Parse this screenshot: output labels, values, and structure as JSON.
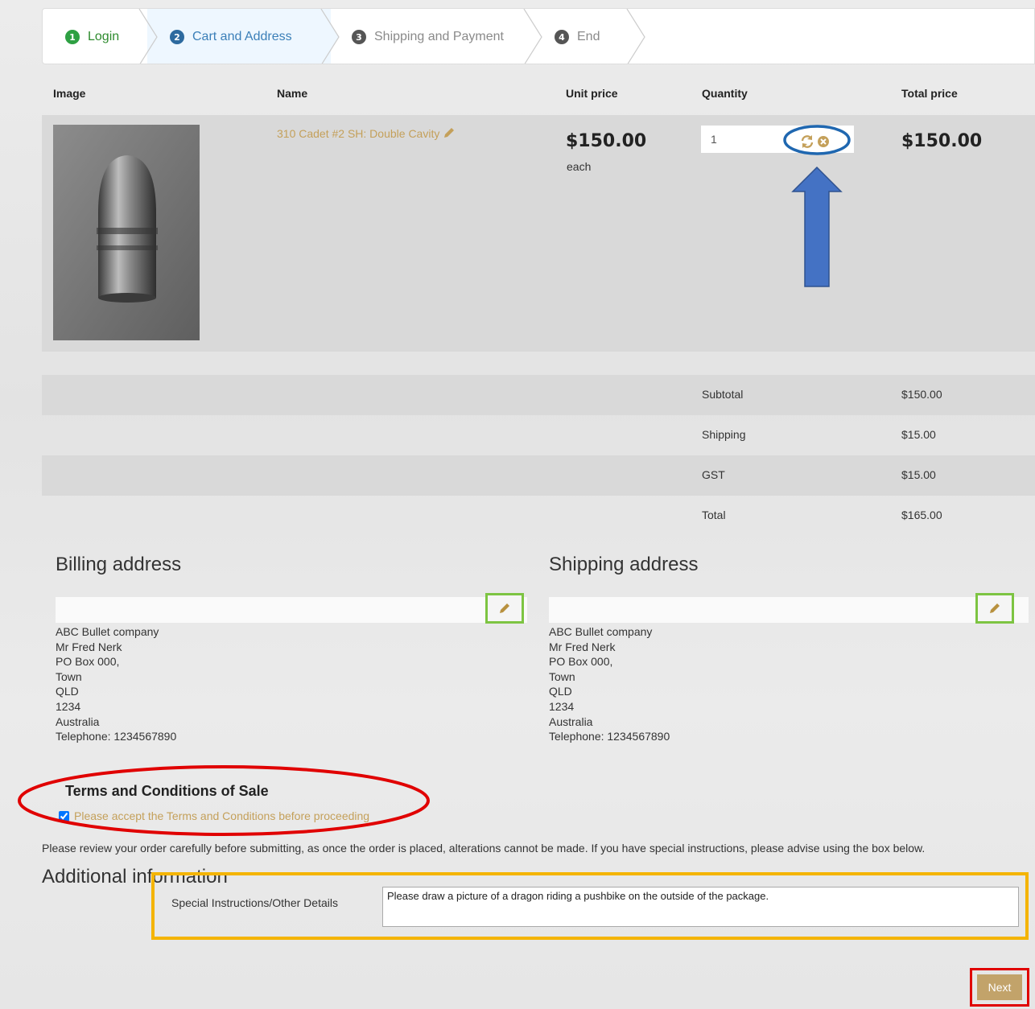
{
  "steps": [
    {
      "num": "1",
      "label": "Login"
    },
    {
      "num": "2",
      "label": "Cart and Address"
    },
    {
      "num": "3",
      "label": "Shipping and Payment"
    },
    {
      "num": "4",
      "label": "End"
    }
  ],
  "table": {
    "headers": {
      "image": "Image",
      "name": "Name",
      "unit_price": "Unit price",
      "quantity": "Quantity",
      "total_price": "Total price"
    },
    "item": {
      "name": "310 Cadet #2 SH: Double Cavity",
      "unit_price": "$150.00",
      "unit_suffix": "each",
      "quantity": "1",
      "total_price": "$150.00"
    }
  },
  "summary": [
    {
      "label": "Subtotal",
      "value": "$150.00"
    },
    {
      "label": "Shipping",
      "value": "$15.00"
    },
    {
      "label": "GST",
      "value": "$15.00"
    },
    {
      "label": "Total",
      "value": "$165.00"
    }
  ],
  "billing": {
    "title": "Billing address",
    "lines": [
      "ABC Bullet company",
      "Mr Fred Nerk",
      "PO Box 000,",
      "Town",
      "QLD",
      "1234",
      "Australia",
      "Telephone: 1234567890"
    ]
  },
  "shipping": {
    "title": "Shipping address",
    "lines": [
      "ABC Bullet company",
      "Mr Fred Nerk",
      "PO Box 000,",
      "Town",
      "QLD",
      "1234",
      "Australia",
      "Telephone: 1234567890"
    ]
  },
  "terms": {
    "title": "Terms and Conditions of Sale",
    "checkbox_label": "Please accept the Terms and Conditions before proceeding"
  },
  "review_text": "Please review your order carefully before submitting, as once the order is placed, alterations cannot be made. If you have special instructions, please advise using the box below.",
  "additional": {
    "title": "Additional information",
    "label": "Special Instructions/Other Details",
    "value": "Please draw a picture of a dragon riding a pushbike on the outside of the package."
  },
  "next_label": "Next",
  "colors": {
    "accent": "#c4a05a",
    "annotation_blue": "#4472c4",
    "annotation_red": "#e00000",
    "annotation_green": "#7dc442",
    "annotation_yellow": "#f4b400"
  },
  "icons": [
    "pencil-icon",
    "refresh-icon",
    "remove-icon",
    "checkbox"
  ]
}
